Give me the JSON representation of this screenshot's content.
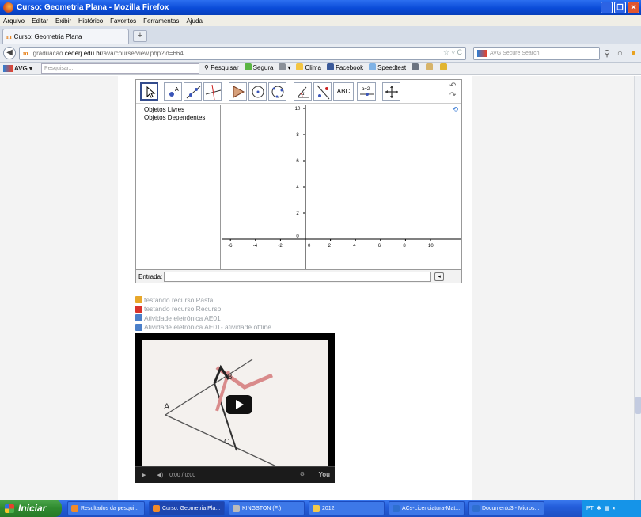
{
  "window": {
    "title": "Curso: Geometria Plana - Mozilla Firefox"
  },
  "menu": [
    "Arquivo",
    "Editar",
    "Exibir",
    "Histórico",
    "Favoritos",
    "Ferramentas",
    "Ajuda"
  ],
  "tab": {
    "brand": "m",
    "label": "Curso: Geometria Plana",
    "new_tab": "+"
  },
  "nav": {
    "url_prefix": "graduacao.",
    "url_domain": "cederj.edu.br",
    "url_path": "/ava/course/view.php?id=664",
    "search_placeholder": "AVG Secure Search"
  },
  "avg_toolbar": {
    "brand": "AVG",
    "search_placeholder": "Pesquisar...",
    "items": [
      "Pesquisar",
      "Segura",
      "Clima",
      "Facebook",
      "Speedtest"
    ]
  },
  "geogebra": {
    "algebra_items": [
      "Objetos Livres",
      "Objetos Dependentes"
    ],
    "input_label": "Entrada:",
    "x_ticks": [
      "-6",
      "-4",
      "-2",
      "0",
      "2",
      "4",
      "6",
      "8",
      "10"
    ],
    "y_ticks": [
      "10",
      "8",
      "6",
      "4",
      "2",
      "0"
    ],
    "abc_tool": "ABC",
    "slider_tool": "a=2"
  },
  "resources": [
    {
      "label": "testando recurso Pasta",
      "icon": "folder-icon",
      "color": "#e8a72a"
    },
    {
      "label": "testando recurso Recurso",
      "icon": "pdf-icon",
      "color": "#d9332b"
    },
    {
      "label": "Atividade eletrônica AE01",
      "icon": "activity-icon",
      "color": "#4b7fc9"
    },
    {
      "label": "Atividade eletrônica AE01- atividade offline",
      "icon": "activity-icon",
      "color": "#4b7fc9"
    }
  ],
  "video": {
    "label_a": "A",
    "label_b": "B",
    "label_c": "C",
    "time": "0:00 / 0:00",
    "brand": "You"
  },
  "taskbar": {
    "start": "Iniciar",
    "buttons": [
      {
        "label": "Resultados da pesqui...",
        "color": "#f08a2a"
      },
      {
        "label": "Curso: Geometria Pla...",
        "color": "#f08a2a"
      },
      {
        "label": "KINGSTON (F:)",
        "color": "#bbbbbb"
      },
      {
        "label": "2012",
        "color": "#f2c94c"
      },
      {
        "label": "ACs-Licenciatura-Mat...",
        "color": "#2f6fd0"
      },
      {
        "label": "Documento3 - Micros...",
        "color": "#2f6fd0"
      }
    ],
    "tray_lang": "PT"
  }
}
